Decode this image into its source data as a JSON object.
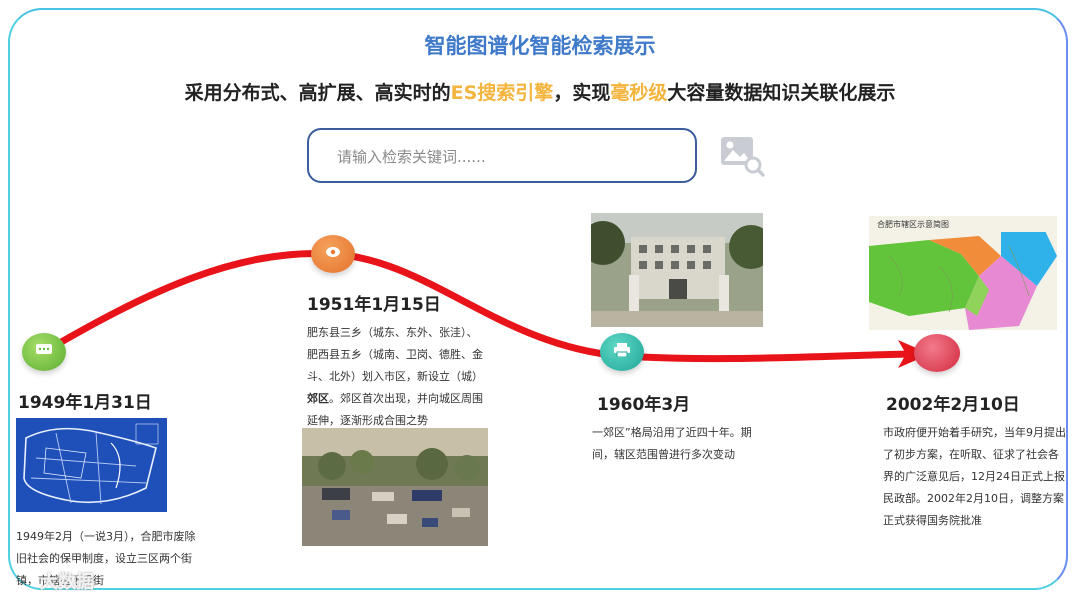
{
  "header": {
    "title": "智能图谱化智能检索展示",
    "subtitle_parts": [
      "采用分布式、高扩展、高实时的",
      "ES搜索引擎",
      "，实现",
      "毫秒级",
      "大容量数据知识关联化展示"
    ]
  },
  "search": {
    "placeholder": "请输入检索关键词......"
  },
  "colors": {
    "title": "#3f79c9",
    "highlight": "#f4b53f",
    "curve": "#e8141a",
    "search_border": "#3b5d9e"
  },
  "timeline": [
    {
      "date": "1949年1月31日",
      "icon": "chat-icon",
      "desc": "1949年2月（一说3月），合肥市废除旧社会的保甲制度，设立三区两个街镇，市辖区下设街"
    },
    {
      "date": "1951年1月15日",
      "icon": "location-pin-icon",
      "desc_parts": [
        "肥东县三乡（城东、东外、张洼）、肥西县五乡（城南、卫岗、德胜、金斗、北外）划入市区，新设立（城）",
        "郊区",
        "。郊区首次出现，并向城区周围延伸，逐渐形成合围之势"
      ]
    },
    {
      "date": "1960年3月",
      "icon": "printer-icon",
      "desc": "一郊区”格局沿用了近四十年。期间，辖区范围曾进行多次变动"
    },
    {
      "date": "2002年2月10日",
      "icon": "end-node",
      "desc": "市政府便开始着手研究，当年9月提出了初步方案，在听取、征求了社会各界的广泛意见后，12月24日正式上报民政部。2002年2月10日，调整方案正式获得国务院批准"
    }
  ],
  "map_label": "合肥市辖区示意简图",
  "watermark": "大数据"
}
